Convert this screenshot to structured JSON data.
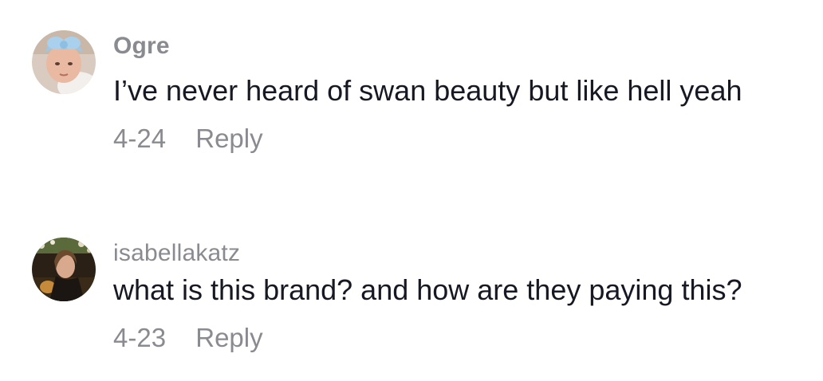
{
  "comments": [
    {
      "username": "Ogre",
      "text": "I’ve never heard of swan beauty but like hell yeah",
      "date": "4-24",
      "reply_label": "Reply",
      "avatar_icon": "baby-with-blue-bow-avatar"
    },
    {
      "username": "isabellakatz",
      "text": "what is this brand? and how are they paying this?",
      "date": "4-23",
      "reply_label": "Reply",
      "avatar_icon": "woman-portrait-avatar"
    }
  ],
  "colors": {
    "text_primary": "#161823",
    "text_secondary": "#8a8b91",
    "background": "#ffffff"
  }
}
